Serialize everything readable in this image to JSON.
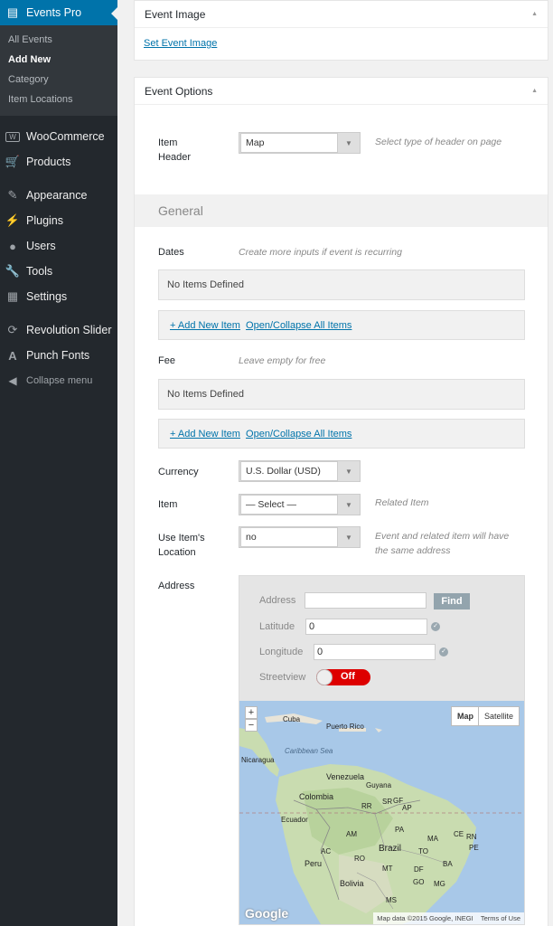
{
  "sidebar": {
    "active": {
      "label": "Events Pro",
      "icon": "calendar-icon"
    },
    "submenu": [
      {
        "label": "All Events",
        "current": false
      },
      {
        "label": "Add New",
        "current": true
      },
      {
        "label": "Category",
        "current": false
      },
      {
        "label": "Item Locations",
        "current": false
      }
    ],
    "items": [
      {
        "label": "WooCommerce",
        "icon": "woocommerce-icon"
      },
      {
        "label": "Products",
        "icon": "cart-icon"
      },
      {
        "label": "Appearance",
        "icon": "paintbrush-icon"
      },
      {
        "label": "Plugins",
        "icon": "plug-icon"
      },
      {
        "label": "Users",
        "icon": "user-icon"
      },
      {
        "label": "Tools",
        "icon": "wrench-icon"
      },
      {
        "label": "Settings",
        "icon": "settings-icon"
      },
      {
        "label": "Revolution Slider",
        "icon": "refresh-icon"
      },
      {
        "label": "Punch Fonts",
        "icon": "font-icon"
      }
    ],
    "collapse": "Collapse menu"
  },
  "event_image": {
    "title": "Event Image",
    "set_link": "Set Event Image"
  },
  "event_options": {
    "title": "Event Options",
    "item_header": {
      "label_line1": "Item",
      "label_line2": "Header",
      "value": "Map",
      "hint": "Select type of header on page"
    },
    "general_title": "General",
    "dates": {
      "label": "Dates",
      "hint": "Create more inputs if event is recurring",
      "empty": "No Items Defined",
      "add": "+ Add New Item",
      "toggle": "Open/Collapse All Items"
    },
    "fee": {
      "label": "Fee",
      "hint": "Leave empty for free",
      "empty": "No Items Defined",
      "add": "+ Add New Item",
      "toggle": "Open/Collapse All Items"
    },
    "currency": {
      "label": "Currency",
      "value": "U.S. Dollar (USD)"
    },
    "item": {
      "label": "Item",
      "value": "— Select —",
      "hint": "Related Item"
    },
    "use_location": {
      "label_line1": "Use Item's",
      "label_line2": "Location",
      "value": "no",
      "hint_line1": "Event and related item will have",
      "hint_line2": "the same address"
    },
    "address": {
      "label": "Address",
      "address_label": "Address",
      "address_value": "",
      "find": "Find",
      "latitude_label": "Latitude",
      "latitude_value": "0",
      "longitude_label": "Longitude",
      "longitude_value": "0",
      "streetview_label": "Streetview",
      "streetview_state": "Off"
    },
    "map": {
      "type_map": "Map",
      "type_satellite": "Satellite",
      "zoom_in": "+",
      "zoom_out": "−",
      "logo": "Google",
      "attribution": "Map data ©2015 Google, INEGI",
      "terms": "Terms of Use",
      "places": [
        "Cuba",
        "Puerto Rico",
        "Caribbean Sea",
        "Nicaragua",
        "Venezuela",
        "Guyana",
        "Colombia",
        "Ecuador",
        "Brazil",
        "Peru",
        "Bolivia",
        "AM",
        "PA",
        "RO",
        "MT",
        "GO",
        "MS",
        "AC",
        "RR",
        "AP",
        "MA",
        "CE",
        "RN",
        "PE",
        "TO",
        "BA",
        "DF",
        "MG",
        "SR",
        "GF"
      ]
    }
  }
}
